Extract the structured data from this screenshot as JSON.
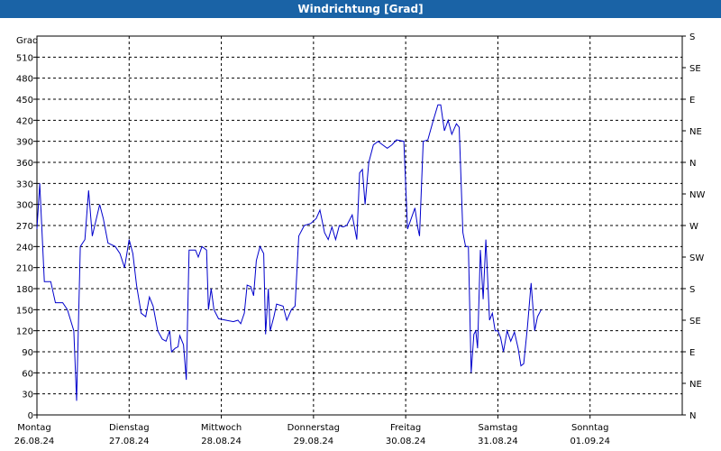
{
  "window": {
    "title": "Windrichtung [Grad]"
  },
  "chart_data": {
    "type": "line",
    "title": "Windrichtung [Grad]",
    "ylabel": "Grad",
    "ylim": [
      0,
      540
    ],
    "y_ticks": [
      0,
      30,
      60,
      90,
      120,
      150,
      180,
      210,
      240,
      270,
      300,
      330,
      360,
      390,
      420,
      450,
      480,
      510
    ],
    "right_ticks": [
      "N",
      "NE",
      "E",
      "SE",
      "S",
      "SW",
      "W",
      "NW",
      "N",
      "NE",
      "E",
      "SE",
      "S"
    ],
    "x_range": [
      "2024-08-26",
      "2024-09-02"
    ],
    "days": [
      {
        "weekday": "Montag",
        "date": "26.08.24"
      },
      {
        "weekday": "Dienstag",
        "date": "27.08.24"
      },
      {
        "weekday": "Mittwoch",
        "date": "28.08.24"
      },
      {
        "weekday": "Donnerstag",
        "date": "29.08.24"
      },
      {
        "weekday": "Freitag",
        "date": "30.08.24"
      },
      {
        "weekday": "Samstag",
        "date": "31.08.24"
      },
      {
        "weekday": "Sonntag",
        "date": "01.09.24"
      }
    ],
    "grid": true,
    "series": [
      {
        "color": "#0000cc",
        "points": [
          [
            0.0,
            265
          ],
          [
            0.03,
            330
          ],
          [
            0.08,
            190
          ],
          [
            0.15,
            190
          ],
          [
            0.2,
            160
          ],
          [
            0.28,
            160
          ],
          [
            0.33,
            150
          ],
          [
            0.4,
            120
          ],
          [
            0.43,
            20
          ],
          [
            0.47,
            240
          ],
          [
            0.52,
            250
          ],
          [
            0.56,
            320
          ],
          [
            0.6,
            255
          ],
          [
            0.68,
            300
          ],
          [
            0.72,
            280
          ],
          [
            0.77,
            245
          ],
          [
            0.85,
            240
          ],
          [
            0.9,
            230
          ],
          [
            0.95,
            210
          ],
          [
            1.0,
            250
          ],
          [
            1.04,
            230
          ],
          [
            1.08,
            185
          ],
          [
            1.13,
            145
          ],
          [
            1.18,
            140
          ],
          [
            1.22,
            168
          ],
          [
            1.26,
            155
          ],
          [
            1.31,
            120
          ],
          [
            1.36,
            108
          ],
          [
            1.4,
            105
          ],
          [
            1.44,
            120
          ],
          [
            1.46,
            90
          ],
          [
            1.5,
            95
          ],
          [
            1.53,
            97
          ],
          [
            1.55,
            113
          ],
          [
            1.59,
            100
          ],
          [
            1.62,
            50
          ],
          [
            1.65,
            235
          ],
          [
            1.72,
            235
          ],
          [
            1.75,
            225
          ],
          [
            1.79,
            240
          ],
          [
            1.84,
            235
          ],
          [
            1.86,
            150
          ],
          [
            1.89,
            180
          ],
          [
            1.92,
            150
          ],
          [
            1.97,
            137
          ],
          [
            2.05,
            135
          ],
          [
            2.13,
            133
          ],
          [
            2.18,
            135
          ],
          [
            2.21,
            130
          ],
          [
            2.25,
            145
          ],
          [
            2.28,
            185
          ],
          [
            2.32,
            183
          ],
          [
            2.35,
            170
          ],
          [
            2.38,
            220
          ],
          [
            2.42,
            240
          ],
          [
            2.46,
            230
          ],
          [
            2.48,
            115
          ],
          [
            2.51,
            180
          ],
          [
            2.53,
            120
          ],
          [
            2.57,
            140
          ],
          [
            2.6,
            158
          ],
          [
            2.67,
            155
          ],
          [
            2.71,
            135
          ],
          [
            2.76,
            150
          ],
          [
            2.8,
            155
          ],
          [
            2.84,
            255
          ],
          [
            2.9,
            270
          ],
          [
            2.97,
            273
          ],
          [
            3.03,
            280
          ],
          [
            3.07,
            292
          ],
          [
            3.12,
            260
          ],
          [
            3.16,
            250
          ],
          [
            3.2,
            268
          ],
          [
            3.24,
            250
          ],
          [
            3.28,
            270
          ],
          [
            3.32,
            268
          ],
          [
            3.36,
            270
          ],
          [
            3.42,
            285
          ],
          [
            3.47,
            250
          ],
          [
            3.5,
            345
          ],
          [
            3.53,
            350
          ],
          [
            3.56,
            300
          ],
          [
            3.6,
            360
          ],
          [
            3.65,
            385
          ],
          [
            3.7,
            390
          ],
          [
            3.75,
            385
          ],
          [
            3.8,
            380
          ],
          [
            3.85,
            385
          ],
          [
            3.9,
            392
          ],
          [
            3.98,
            390
          ],
          [
            4.02,
            265
          ],
          [
            4.06,
            280
          ],
          [
            4.1,
            295
          ],
          [
            4.13,
            268
          ],
          [
            4.15,
            255
          ],
          [
            4.19,
            390
          ],
          [
            4.24,
            392
          ],
          [
            4.3,
            420
          ],
          [
            4.35,
            442
          ],
          [
            4.38,
            442
          ],
          [
            4.42,
            405
          ],
          [
            4.46,
            420
          ],
          [
            4.5,
            400
          ],
          [
            4.55,
            415
          ],
          [
            4.58,
            410
          ],
          [
            4.62,
            260
          ],
          [
            4.65,
            240
          ],
          [
            4.68,
            240
          ],
          [
            4.71,
            60
          ],
          [
            4.74,
            115
          ],
          [
            4.76,
            120
          ],
          [
            4.78,
            95
          ],
          [
            4.81,
            235
          ],
          [
            4.84,
            165
          ],
          [
            4.87,
            250
          ],
          [
            4.91,
            135
          ],
          [
            4.94,
            145
          ],
          [
            4.97,
            120
          ],
          [
            5.0,
            120
          ],
          [
            5.03,
            110
          ],
          [
            5.06,
            90
          ],
          [
            5.1,
            120
          ],
          [
            5.14,
            105
          ],
          [
            5.18,
            118
          ],
          [
            5.22,
            95
          ],
          [
            5.25,
            70
          ],
          [
            5.28,
            73
          ],
          [
            5.32,
            125
          ],
          [
            5.36,
            188
          ],
          [
            5.4,
            120
          ],
          [
            5.43,
            140
          ],
          [
            5.47,
            150
          ]
        ]
      }
    ]
  }
}
